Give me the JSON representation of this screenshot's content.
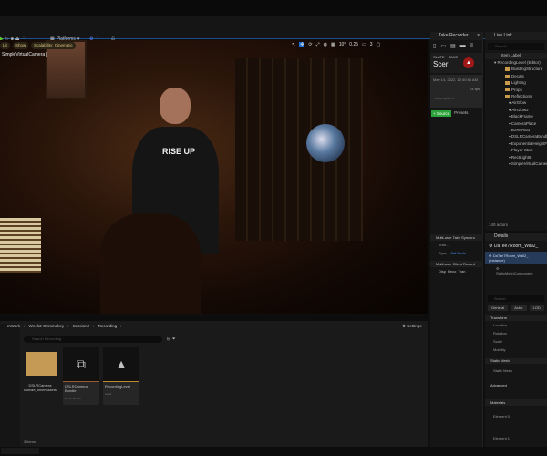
{
  "toolbar": {
    "platforms_label": "Platforms"
  },
  "viewport": {
    "lit_label": "Lit",
    "show_label": "Show",
    "scalability_label": "Scalability: Cinematic",
    "camera_label": "SimpleVirtualCamera ]",
    "fov": "0.25",
    "speed": "3",
    "angle": "10°",
    "shirt_text": "RISE UP"
  },
  "take_recorder": {
    "title": "Take Recorder",
    "slate_label": "SLATE",
    "take_label": "TAKE",
    "slate_value": "Scer",
    "date": "May 14, 2022, 12:40:55 AM",
    "fps": "24 fps",
    "description_placeholder": "<description>",
    "source_button": "+ Source",
    "presets_button": "Presets",
    "sync_title": "Multi-user Take Synchro",
    "tran_label": "Tran...",
    "sync_label": "Sync...",
    "sync_value": "Set Exclu",
    "client_title": "Multi-user Client Record",
    "client_buttons": [
      "Disp",
      "Reco",
      "Tran"
    ]
  },
  "live_link": {
    "title": "Live Link",
    "search_placeholder": "Search",
    "column": "Item Label",
    "root": "RecordingLevel (Editor)",
    "items": [
      {
        "label": "BuildingStructure",
        "type": "folder"
      },
      {
        "label": "Decals",
        "type": "folder"
      },
      {
        "label": "Lighting",
        "type": "folder"
      },
      {
        "label": "Props",
        "type": "folder"
      },
      {
        "label": "Reflections",
        "type": "folder"
      },
      {
        "label": "AirGlow",
        "type": "light"
      },
      {
        "label": "AirGlow2",
        "type": "light"
      },
      {
        "label": "BlackFrame",
        "type": "actor"
      },
      {
        "label": "CameraPlace",
        "type": "actor"
      },
      {
        "label": "DaTe7Cat",
        "type": "actor"
      },
      {
        "label": "DSLRCameraBundle",
        "type": "actor"
      },
      {
        "label": "ExponentialHeightFog",
        "type": "actor"
      },
      {
        "label": "Player Start",
        "type": "actor"
      },
      {
        "label": "RectLight6",
        "type": "actor"
      },
      {
        "label": "SimpleVirtualCamera",
        "type": "actor"
      }
    ],
    "actor_count": "140 actors"
  },
  "details": {
    "title": "Details",
    "actor_name": "DaTee7Room_Wall2_",
    "instance": "DaTee7Room_Wall2_ (Instance)",
    "component": "StaticMeshComponent",
    "search_placeholder": "Search",
    "tabs": [
      "General",
      "Actor",
      "LOD"
    ],
    "sections": {
      "transform": "Transform",
      "location": "Location",
      "rotation": "Rotation",
      "scale": "Scale",
      "mobility": "Mobility",
      "static_mesh_section": "Static Mesh",
      "static_mesh": "Static Mesh",
      "advanced": "Advanced",
      "materials": "Materials",
      "element0": "Element 0",
      "element1": "Element 1"
    }
  },
  "content_browser": {
    "breadcrumb": [
      "mWork",
      "Week3-Chromakey",
      "Session2",
      "Recording"
    ],
    "settings": "Settings",
    "search_placeholder": "Search Recording",
    "items": [
      {
        "name": "DSLRCamera Bundle_InnerAssets",
        "type": ""
      },
      {
        "name": "DSLRCamera Bundle",
        "type": "Media Bundle"
      },
      {
        "name": "RecordingLevel",
        "type": "Level"
      }
    ],
    "count": "3 items"
  }
}
